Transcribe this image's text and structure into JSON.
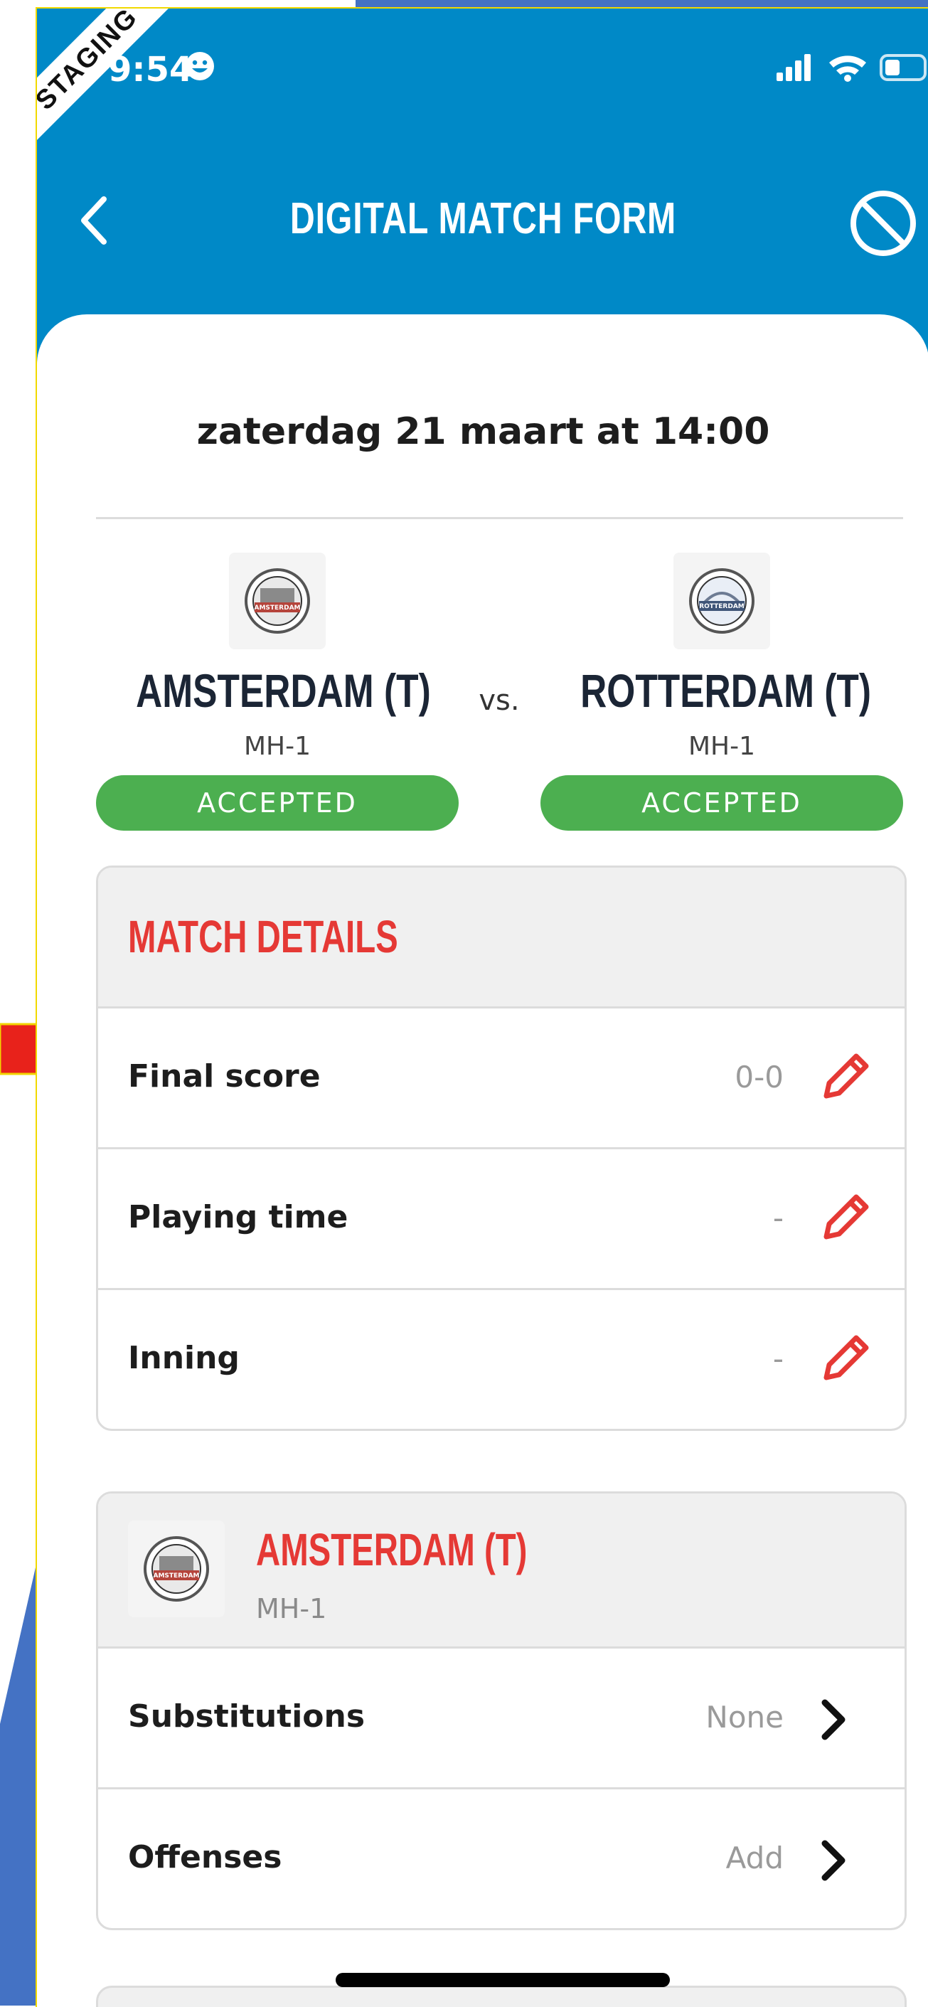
{
  "status_bar": {
    "time": "9:54",
    "staging_label": "STAGING"
  },
  "nav": {
    "title": "DIGITAL MATCH FORM"
  },
  "match": {
    "date": "zaterdag 21 maart at 14:00",
    "vs_label": "vs.",
    "home": {
      "name": "AMSTERDAM (T)",
      "code": "MH-1",
      "status": "ACCEPTED",
      "logo_text": "AMSTERDAM"
    },
    "away": {
      "name": "ROTTERDAM (T)",
      "code": "MH-1",
      "status": "ACCEPTED",
      "logo_text": "ROTTERDAM"
    }
  },
  "match_details": {
    "title": "MATCH DETAILS",
    "rows": [
      {
        "label": "Final score",
        "value": "0-0"
      },
      {
        "label": "Playing time",
        "value": "-"
      },
      {
        "label": "Inning",
        "value": "-"
      }
    ]
  },
  "team_section": {
    "name": "AMSTERDAM (T)",
    "code": "MH-1",
    "rows": [
      {
        "label": "Substitutions",
        "value": "None"
      },
      {
        "label": "Offenses",
        "value": "Add"
      }
    ]
  },
  "icons": [
    "back-chevron-icon",
    "cancel-circle-icon",
    "pencil-icon",
    "chevron-right-icon",
    "team-logo-icon",
    "red-arrow-icon"
  ],
  "colors": {
    "header_blue": "#0089c7",
    "accent_red": "#e53935",
    "accepted_green": "#4caf50",
    "text_dark": "#1b2535"
  }
}
